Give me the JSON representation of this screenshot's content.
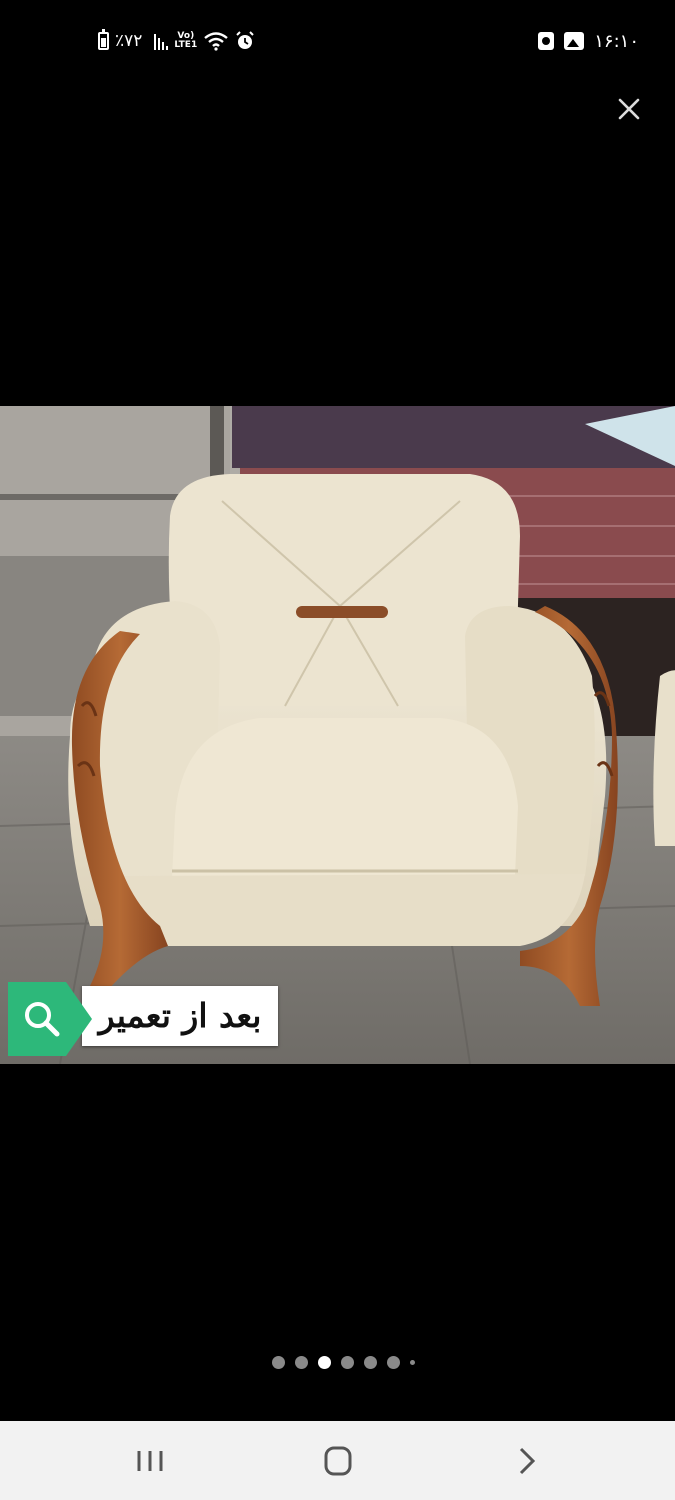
{
  "status_bar": {
    "battery_text": "٪۷۲",
    "network_top": "Vo)",
    "network_bottom": "LTE1",
    "time": "۱۶:۱۰",
    "icons": [
      "battery-icon",
      "signal-icon",
      "volte-icon",
      "wifi-icon",
      "alarm-icon",
      "screen-record-icon",
      "gallery-icon"
    ]
  },
  "viewer": {
    "close_icon": "close-icon",
    "caption_text": "بعد از تعمیر",
    "caption_icon": "search-icon",
    "accent_color": "#2db87a",
    "pages": {
      "count": 7,
      "current": 3
    }
  },
  "nav": {
    "icons": [
      "recent-apps-icon",
      "home-icon",
      "back-icon"
    ]
  }
}
